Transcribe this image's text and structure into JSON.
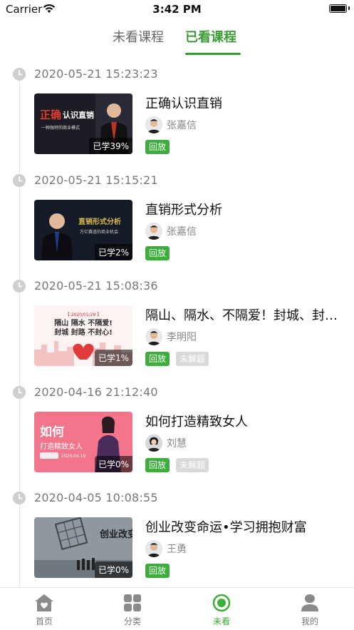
{
  "status_bar": {
    "carrier": "Carrier",
    "time": "3:42 PM"
  },
  "tabs": {
    "unwatched": "未看课程",
    "watched": "已看课程"
  },
  "entries": [
    {
      "time": "2020-05-21 15:23:23",
      "title": "正确认识直销",
      "teacher": "张嘉信",
      "progress": "已学39%",
      "tags": [
        "回放"
      ],
      "thumb": {
        "top": "正确",
        "main": "认识直销",
        "sub": "一种独特的商业模式",
        "bg": "#1c1c24",
        "accent": "#e23b2e"
      }
    },
    {
      "time": "2020-05-21 15:15:21",
      "title": "直销形式分析",
      "teacher": "张嘉信",
      "progress": "已学2%",
      "tags": [
        "回放"
      ],
      "thumb": {
        "main": "直销形式分析",
        "sub": "万亿赛道的商业机会",
        "bg": "#141a26",
        "accent": "#d9b84f"
      }
    },
    {
      "time": "2020-05-21 15:08:36",
      "title": "隔山、隔水、不隔爱！封城、封路、不封心",
      "teacher": "李明阳",
      "progress": "已学1%",
      "tags": [
        "回放",
        "未解题"
      ],
      "thumb": {
        "date": "【 2020/01/29 】",
        "line1": "隔山 隔水 不隔爱!",
        "line2": "封城 封路 不封心!",
        "bg": "#fdf3f3",
        "accent": "#c8282a"
      }
    },
    {
      "time": "2020-04-16 21:12:40",
      "title": "如何打造精致女人",
      "teacher": "刘慧",
      "progress": "已学0%",
      "tags": [
        "回放",
        "未解题"
      ],
      "thumb": {
        "main": "如何",
        "sub": "打造精致女人",
        "date": "2020.04.16",
        "bg": "#f2758b",
        "accent": "#ffffff"
      }
    },
    {
      "time": "2020-04-05 10:08:55",
      "title": "创业改变命运•学习拥抱财富",
      "teacher": "王勇",
      "progress": "已学0%",
      "tags": [
        "回放"
      ],
      "thumb": {
        "main": "创业改变命运",
        "bg": "#8e989e",
        "accent": "#1e1e1e"
      }
    }
  ],
  "nav": {
    "home": "首页",
    "category": "分类",
    "unwatched": "未看",
    "mine": "我的"
  },
  "colors": {
    "accent_green": "#3cae3c",
    "tab_green": "#3a9b35"
  }
}
